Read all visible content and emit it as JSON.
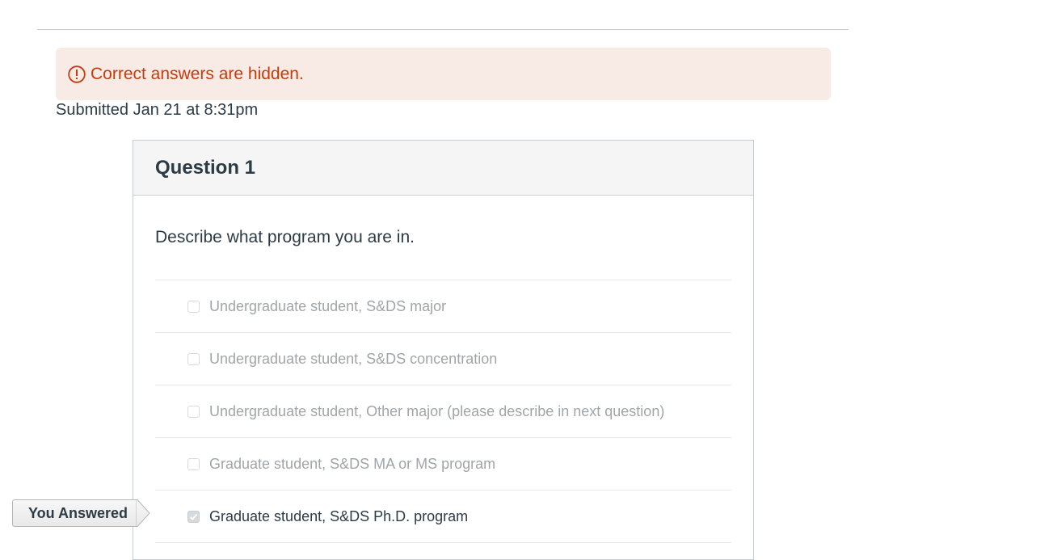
{
  "alert": {
    "text": "Correct answers are hidden.",
    "icon": "warning-icon",
    "color": "#c23c0d",
    "background": "#f8ebe6"
  },
  "submission": {
    "text": "Submitted Jan 21 at 8:31pm"
  },
  "question": {
    "title": "Question 1",
    "prompt": "Describe what program you are in.",
    "answers": [
      {
        "label": "Undergraduate student, S&DS major",
        "checked": false
      },
      {
        "label": "Undergraduate student, S&DS concentration",
        "checked": false
      },
      {
        "label": "Undergraduate student, Other major (please describe in next question)",
        "checked": false
      },
      {
        "label": "Graduate student, S&DS MA or MS program",
        "checked": false
      },
      {
        "label": "Graduate student, S&DS Ph.D. program",
        "checked": true
      }
    ]
  },
  "you_answered": {
    "label": "You Answered"
  }
}
